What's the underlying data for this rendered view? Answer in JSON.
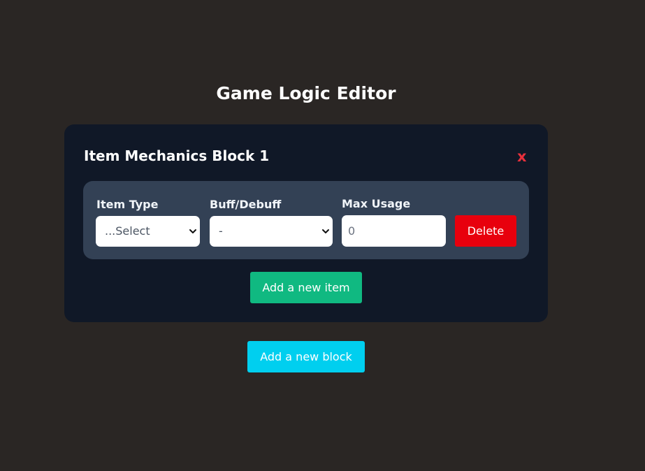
{
  "page": {
    "title": "Game Logic Editor"
  },
  "block": {
    "title": "Item Mechanics Block 1",
    "close_label": "x",
    "item": {
      "item_type_label": "Item Type",
      "item_type_value": "...Select",
      "buff_label": "Buff/Debuff",
      "buff_value": "-",
      "max_usage_label": "Max Usage",
      "max_usage_value": "0",
      "delete_label": "Delete"
    },
    "add_item_label": "Add a new item"
  },
  "add_block_label": "Add a new block",
  "colors": {
    "background": "#2a2624",
    "card": "#101827",
    "item_row": "#334155",
    "close": "#e8303c",
    "delete": "#e8000d",
    "add_item": "#10b981",
    "add_block": "#00cfef"
  },
  "icons": {
    "select_arrow": "chevron-down-icon"
  }
}
